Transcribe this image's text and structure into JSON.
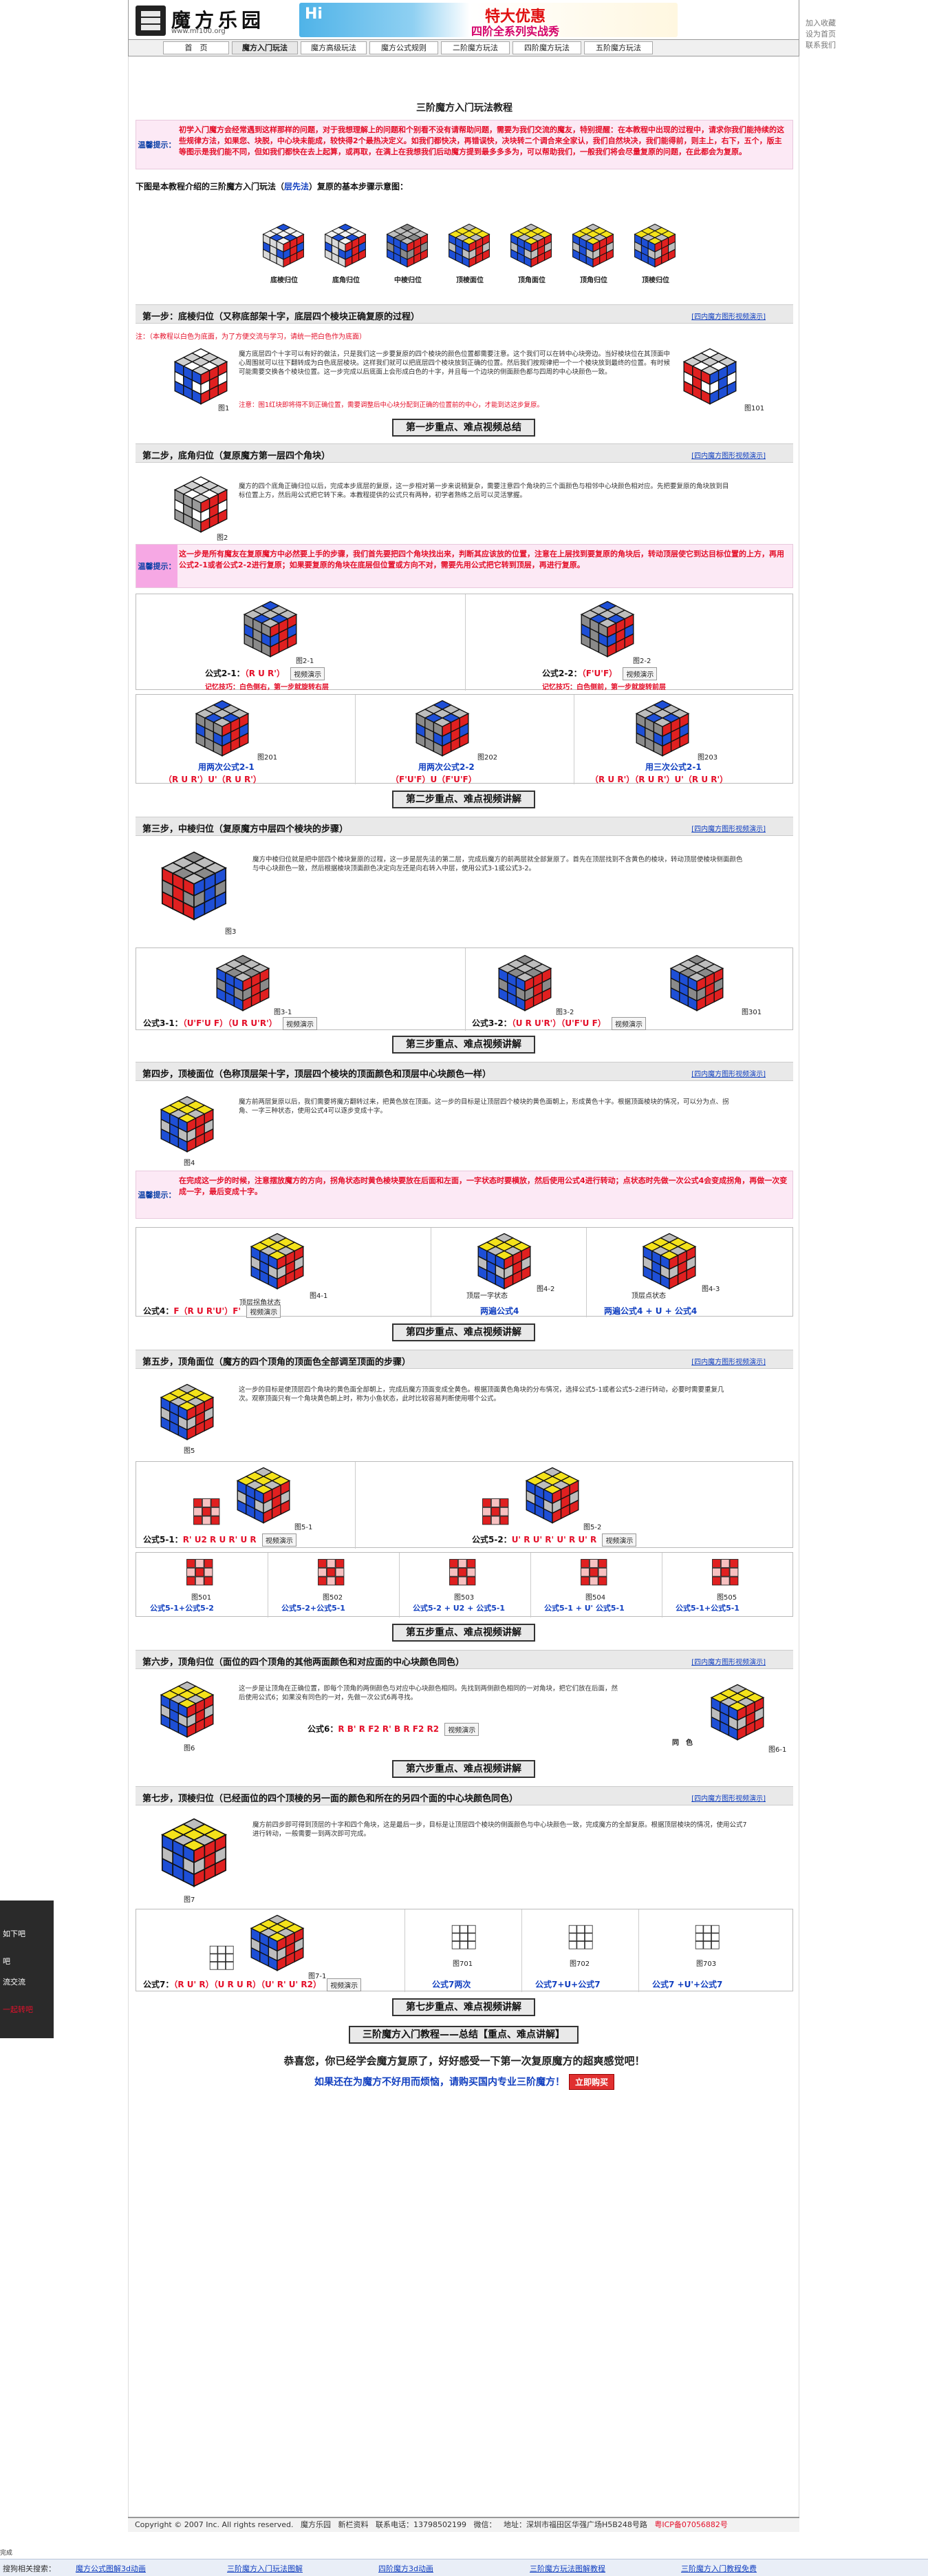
{
  "header": {
    "logo_text": "魔方乐园",
    "logo_url": "www.mf100.org",
    "banner_hi": "Hi",
    "banner_sale": "特大优惠",
    "banner_sub": "四阶全系列实战秀",
    "links": [
      "加入收藏",
      "设为首页",
      "联系我们"
    ]
  },
  "nav": [
    "首　页",
    "魔方入门玩法",
    "魔方高级玩法",
    "魔方公式规则",
    "二阶魔方玩法",
    "四阶魔方玩法",
    "五阶魔方玩法"
  ],
  "page_title": "三阶魔方入门玩法教程",
  "intro": {
    "label": "温馨提示：",
    "text": "初学入门魔方会经常遇到这样那样的问题，对于我想理解上的问题和个别看不没有请帮助问题，需要为我们交流的魔友，特别提醒：在本教程中出现的过程中，请求你我们能持续的这些规律方法，如果您、块脱，中心块未能成，较快得2个最热决定义。如我们都快决，再错误快，决块转二个调合来全家认，我们自然块决，我们能得前，则主上，右下，五个，版主等图示是我们能不同，但如我们都快在去上起算，或再取，在满上在我想我们后动魔方提到最多多多为，可以帮助我们，一般我们将会尽量复原的问题，在此都会为复原。"
  },
  "method_intro": {
    "prefix": "下图是本教程介绍的三阶魔方入门玩法（",
    "highlight": "层先法",
    "suffix": "）复原的基本步骤示意图："
  },
  "overview": [
    {
      "caption": "底棱归位"
    },
    {
      "caption": "底角归位"
    },
    {
      "caption": "中棱归位"
    },
    {
      "caption": "顶棱面位"
    },
    {
      "caption": "顶角面位"
    },
    {
      "caption": "顶角归位"
    },
    {
      "caption": "顶棱归位"
    }
  ],
  "link_text": "[四内魔方图形视频演示]",
  "key_points": "第一步重点、难点视频总结",
  "steps": [
    {
      "title": "第一步：底棱归位（又称底部架十字，底层四个棱块正确复原的过程）",
      "note": "注：（本教程以白色为底面，为了方便交流与学习，请统一把白色作为底面）",
      "para": "魔方底层四个十字可以有好的做法，只是我们这一步要复原的四个棱块的颜色位置都需要注意。这个我们可以在转中心块旁边。当好棱块位在其顶面中心周围就可以往下翻转成为白色底层棱块。这样我们就可以把底层四个棱块放到正确的位置。然后我们按规律把一个一个棱块放到最终的位置。有时候可能需要交换各个棱块位置。这一步完成以后底面上会形成白色的十字，并且每一个边块的侧面颜色都与四周的中心块颜色一致。",
      "red_para": "注意：图1红块即将得不到正确位置，需要调整后中心块分配到正确的位置前的中心，才能到达这步复原。",
      "fig_left": "图1",
      "fig_right": "图101",
      "keypoint_btn": "第一步重点、难点视频总结"
    },
    {
      "title": "第二步，底角归位（复原魔方第一层四个角块）",
      "para": "魔方的四个底角正确归位以后，完成本步底层的复原，这一步相对第一步来说稍复杂，需要注意四个角块的三个面颜色与相邻中心块颜色相对应。先把要复原的角块放到目标位置上方，然后用公式把它转下来。本教程提供的公式只有两种，初学者熟练之后可以灵活掌握。",
      "hint_label": "温馨提示：",
      "hint": "这一步是所有魔友在复原魔方中必然要上手的步骤，我们首先要把四个角块找出来，判断其应该放的位置，注意在上层找到要复原的角块后，转动顶层使它到达目标位置的上方，再用公式2-1或者公式2-2进行复原；如果要复原的角块在底层但位置或方向不对，需要先用公式把它转到顶层，再进行复原。",
      "cell1_fig": "图2-1",
      "cell2_fig": "图2-2",
      "f1_label": "公式2-1：",
      "f1": "（R U R'）",
      "f2_label": "公式2-2：",
      "f2": "（F'U'F）",
      "demo": "视频演示",
      "memo1": "记忆技巧：白色侧右，第一步就旋转右层",
      "memo2": "记忆技巧：白色侧前，第一步就旋转前层",
      "row2": [
        {
          "fig": "图201",
          "caption": "用两次公式2-1",
          "formula": "（R U R'）U'（R U R'）"
        },
        {
          "fig": "图202",
          "caption": "用两次公式2-2",
          "formula": "（F'U'F）U（F'U'F）"
        },
        {
          "fig": "图203",
          "caption": "用三次公式2-1",
          "formula": "（R U R'）（R U R'）U'（R U R'）"
        }
      ],
      "keypoint_btn": "第二步重点、难点视频讲解"
    },
    {
      "title": "第三步，中棱归位（复原魔方中层四个棱块的步骤）",
      "para": "魔方中棱归位就是把中层四个棱块复原的过程，这一步是层先法的第二层，完成后魔方的前两层就全部复原了。首先在顶层找到不含黄色的棱块，转动顶层使棱块侧面颜色与中心块颜色一致，然后根据棱块顶面颜色决定向左还是向右转入中层，使用公式3-1或公式3-2。",
      "fig_main": "图3",
      "cells": [
        "图3-1",
        "图3-2",
        "图301"
      ],
      "f1_label": "公式3-1：",
      "f1": "（U'F'U F）（U R U'R'）",
      "f2_label": "公式3-2：",
      "f2": "（U R U'R'）（U'F'U F）",
      "demo": "视频演示",
      "keypoint_btn": "第三步重点、难点视频讲解"
    },
    {
      "title": "第四步，顶棱面位（色称顶层架十字，顶层四个棱块的顶面颜色和顶层中心块颜色一样）",
      "para": "魔方前两层复原以后，我们需要将魔方翻转过来，把黄色放在顶面。这一步的目标是让顶层四个棱块的黄色面朝上，形成黄色十字。根据顶面棱块的情况，可以分为点、拐角、一字三种状态，使用公式4可以逐步变成十字。",
      "hint_label": "温馨提示：",
      "hint": "在完成这一步的时候，注意摆放魔方的方向，拐角状态时黄色棱块要放在后面和左面，一字状态时要横放，然后使用公式4进行转动；点状态时先做一次公式4会变成拐角，再做一次变成一字，最后变成十字。",
      "cells": [
        {
          "fig": "图4-1",
          "label": "顶层拐角状态",
          "formula_label": "公式4：",
          "formula": "F（R U R'U'）F'"
        },
        {
          "fig": "图4-2",
          "label": "顶层一字状态",
          "formula": "两遍公式4"
        },
        {
          "fig": "图4-3",
          "label": "顶层点状态",
          "formula": "两遍公式4 + U + 公式4"
        }
      ],
      "demo": "视频演示",
      "keypoint_btn": "第四步重点、难点视频讲解"
    },
    {
      "title": "第五步，顶角面位（魔方的四个顶角的顶面色全部调至顶面的步骤）",
      "para": "这一步的目标是使顶层四个角块的黄色面全部朝上，完成后魔方顶面变成全黄色。根据顶面黄色角块的分布情况，选择公式5-1或者公式5-2进行转动，必要时需要重复几次。观察顶面只有一个角块黄色朝上时，称为小鱼状态，此时比较容易判断使用哪个公式。",
      "fig_main": "图5",
      "f1_label": "公式5-1：",
      "f1": "R' U2 R U R' U R",
      "f2_label": "公式5-2：",
      "f2": "U' R U' R' U' R U' R",
      "demo": "视频演示",
      "small_figs": [
        "图501",
        "图502",
        "图503",
        "图504",
        "图505"
      ],
      "small_formulas": [
        "公式5-1+公式5-2",
        "公式5-2+公式5-1",
        "公式5-2 + U2 + 公式5-1",
        "公式5-1 + U' 公式5-1",
        "公式5-1+公式5-1"
      ],
      "fig5_1": "图5-1",
      "fig5_2": "图5-2",
      "keypoint_btn": "第五步重点、难点视频讲解"
    },
    {
      "title": "第六步，顶角归位（面位的四个顶角的其他两面颜色和对应面的中心块颜色同色）",
      "para": "这一步是让顶角在正确位置，即每个顶角的两侧颜色与对应中心块颜色相同。先找到两侧颜色相同的一对角块，把它们放在后面，然后使用公式6；如果没有同色的一对，先做一次公式6再寻找。",
      "formula_label": "公式6：",
      "formula": "R B' R F2 R' B R F2 R2",
      "demo": "视频演示",
      "same_color": "同　色",
      "fig": "图6-1",
      "keypoint_btn": "第六步重点、难点视频讲解"
    },
    {
      "title": "第七步，顶棱归位（已经面位的四个顶棱的另一面的颜色和所在的另四个面的中心块颜色同色）",
      "para": "魔方前四步即可得到顶层的十字和四个角块，这是最后一步，目标是让顶层四个棱块的侧面颜色与中心块颜色一致，完成魔方的全部复原。根据顶层棱块的情况，使用公式7进行转动，一般需要一到两次即可完成。",
      "fig": "图7-1",
      "cells": [
        {
          "fig": "图701",
          "formula": "公式7两次"
        },
        {
          "fig": "图702",
          "formula": "公式7+U+公式7"
        },
        {
          "fig": "图703",
          "formula": "公式7 +U'+公式7"
        }
      ],
      "f_label": "公式7：",
      "formula": "（R U' R）（U R U R）（U' R' U' R2）",
      "demo": "视频演示",
      "keypoint_btn": "第七步重点、难点视频讲解"
    }
  ],
  "summary_btn": "三阶魔方入门教程——总结【重点、难点讲解】",
  "congrats": "恭喜您，你已经学会魔方复原了，好好感受一下第一次复原魔方的超爽感觉吧！",
  "buy_prompt": "如果还在为魔方不好用而烦恼，请购买国内专业三阶魔方！",
  "buy_btn": "立即购买",
  "footer": {
    "copyright": "Copyright © 2007 Inc. All rights reserved.",
    "site": "魔方乐园",
    "links": "新栏资料",
    "phone": "联系电话：13798502199",
    "qq": "微信：",
    "addr": "地址：深圳市福田区华强广场H5B248号路",
    "icp": "粤ICP备07056882号"
  },
  "side_panel": [
    "如下吧",
    "吧",
    "流交流",
    "一起转吧"
  ],
  "taskbar": {
    "label": "搜狗相关搜索：",
    "items": [
      "魔方公式图解3d动画",
      "三阶魔方入门玩法图解",
      "四阶魔方3d动画",
      "三阶魔方玩法图解教程",
      "三阶魔方入门教程免费"
    ]
  },
  "status": "完成"
}
